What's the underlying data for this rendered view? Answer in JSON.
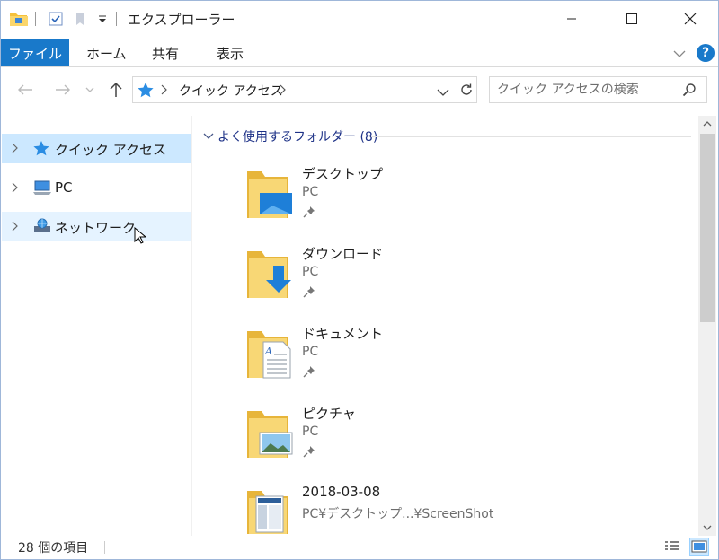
{
  "window": {
    "title": "エクスプローラー"
  },
  "ribbon": {
    "file_tab": "ファイル",
    "tabs": [
      "ホーム",
      "共有",
      "表示"
    ],
    "help": "?"
  },
  "address": {
    "breadcrumb": "クイック アクセス",
    "search_placeholder": "クイック アクセスの検索"
  },
  "nav_pane": {
    "items": [
      {
        "label": "クイック アクセス",
        "icon": "star-icon",
        "state": "selected"
      },
      {
        "label": "PC",
        "icon": "pc-icon",
        "state": "normal"
      },
      {
        "label": "ネットワーク",
        "icon": "network-icon",
        "state": "hover"
      }
    ]
  },
  "content": {
    "group_header": "よく使用するフォルダー (8)",
    "folders": [
      {
        "name": "デスクトップ",
        "location": "PC",
        "pinned": true,
        "icon": "desktop-folder-icon"
      },
      {
        "name": "ダウンロード",
        "location": "PC",
        "pinned": true,
        "icon": "downloads-folder-icon"
      },
      {
        "name": "ドキュメント",
        "location": "PC",
        "pinned": true,
        "icon": "documents-folder-icon"
      },
      {
        "name": "ピクチャ",
        "location": "PC",
        "pinned": true,
        "icon": "pictures-folder-icon"
      },
      {
        "name": "2018-03-08",
        "location": "PC¥デスクトップ...¥ScreenShot",
        "pinned": false,
        "icon": "screenshot-folder-icon"
      }
    ]
  },
  "status": {
    "item_count": "28 個の項目"
  },
  "colors": {
    "accent": "#1979ca",
    "selection": "#cce8ff",
    "hover": "#e5f3ff",
    "group_header": "#1e3287"
  }
}
